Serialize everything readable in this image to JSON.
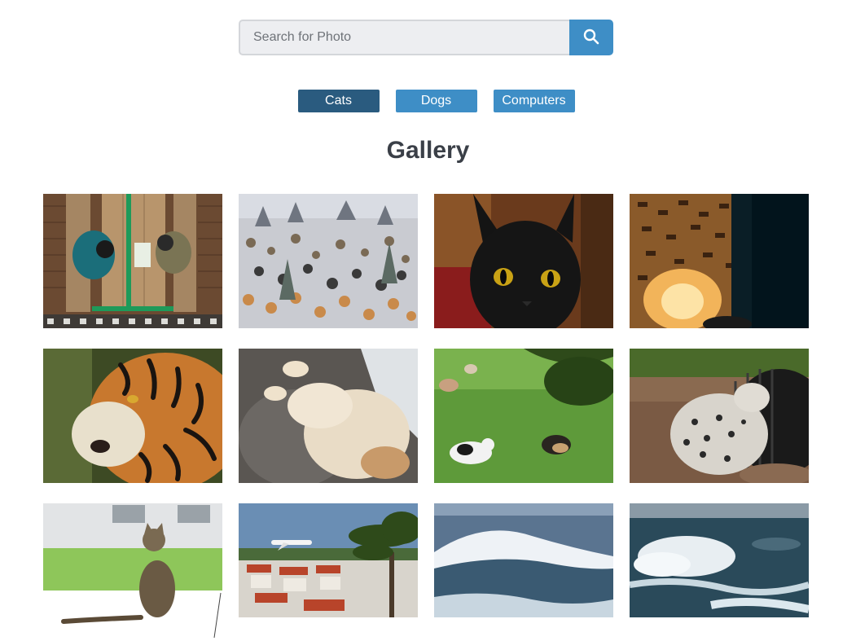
{
  "search": {
    "placeholder": "Search for Photo",
    "value": "",
    "icon": "search-icon"
  },
  "filters": [
    {
      "label": "Cats",
      "active": true
    },
    {
      "label": "Dogs",
      "active": false
    },
    {
      "label": "Computers",
      "active": false
    }
  ],
  "gallery": {
    "title": "Gallery",
    "photos": [
      {
        "subject": "two people at a picnic table from above"
      },
      {
        "subject": "crowd of painted cats in a snowy landscape"
      },
      {
        "subject": "black cat with yellow eyes"
      },
      {
        "subject": "patterned lamp glowing in the dark"
      },
      {
        "subject": "tiger portrait"
      },
      {
        "subject": "fluffy cat lying on its back"
      },
      {
        "subject": "cats playing on green grass"
      },
      {
        "subject": "snow leopard beside a black pipe"
      },
      {
        "subject": "tabby cat sitting on a ledge"
      },
      {
        "subject": "airplane over rooftops and palm tree"
      },
      {
        "subject": "ocean wave breaking"
      },
      {
        "subject": "rough sea with white foam"
      }
    ]
  },
  "colors": {
    "accent": "#3e8ec6",
    "active_filter": "#2a5b7f",
    "title": "#3a3f47",
    "search_bg": "#edeef1"
  }
}
